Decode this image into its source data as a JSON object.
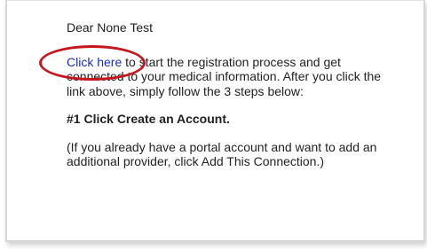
{
  "email": {
    "greeting": "Dear None Test",
    "link_text": "Click here",
    "intro_rest": " to start the registration process and get connected to your medical information. After you click the link above, simply follow the 3 steps below:",
    "step1": "#1 Click Create an Account.",
    "note": "(If you already have a portal account and want to add an additional provider, click Add This Connection.)"
  },
  "colors": {
    "link": "#1a2fb8",
    "highlight_ring": "#c5161d",
    "text": "#222222"
  }
}
